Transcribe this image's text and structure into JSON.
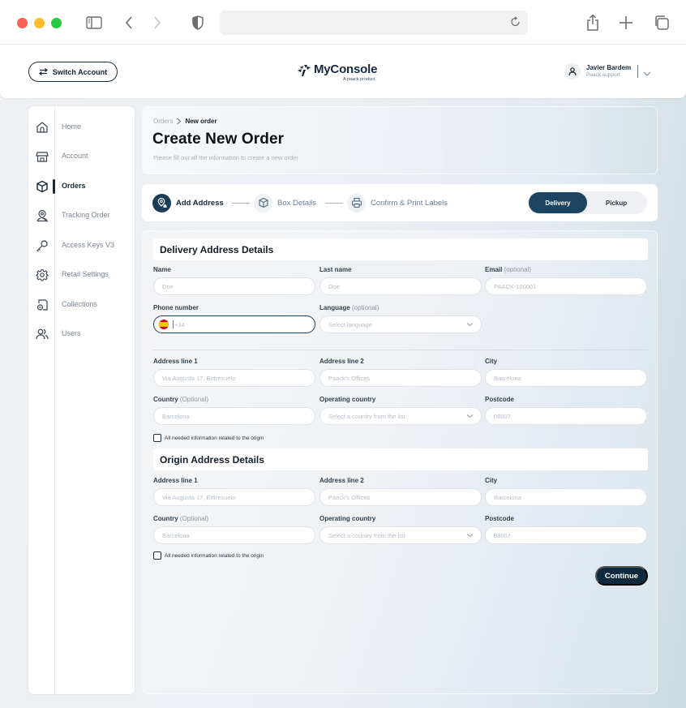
{
  "browser": {
    "icons": [
      "sidebar-toggle-icon",
      "back-icon",
      "forward-icon",
      "privacy-shield-icon",
      "reload-icon",
      "share-icon",
      "new-tab-icon",
      "tabs-overview-icon"
    ],
    "url": ""
  },
  "header": {
    "switch_account_label": "Switch Account",
    "logo_title": "MyConsole",
    "logo_subtitle": "A paack product",
    "user_name": "Javier Bardem",
    "user_role": "Paack support"
  },
  "sidebar": {
    "items": [
      {
        "label": "Home",
        "icon": "home-icon",
        "active": false
      },
      {
        "label": "Account",
        "icon": "store-icon",
        "active": false
      },
      {
        "label": "Orders",
        "icon": "package-icon",
        "active": true
      },
      {
        "label": "Tracking Order",
        "icon": "location-user-icon",
        "active": false
      },
      {
        "label": "Access Keys V3",
        "icon": "key-icon",
        "active": false
      },
      {
        "label": "Retail Settings",
        "icon": "gear-icon",
        "active": false
      },
      {
        "label": "Collections",
        "icon": "collections-icon",
        "active": false
      },
      {
        "label": "Users",
        "icon": "users-icon",
        "active": false
      }
    ]
  },
  "page": {
    "breadcrumb": [
      "Orders",
      "New order"
    ],
    "title": "Create New Order",
    "subtitle": "Please fill out all the information to create a new order"
  },
  "stepper": {
    "steps": [
      {
        "label": "Add Address",
        "active": true
      },
      {
        "label": "Box Details",
        "active": false
      },
      {
        "label": "Confirm & Print Labels",
        "active": false
      }
    ],
    "mode_options": [
      "Delivery",
      "Pickup"
    ],
    "selected_mode": "Delivery"
  },
  "delivery": {
    "title": "Delivery Address Details",
    "name": {
      "label": "Name",
      "placeholder": "Doe"
    },
    "last_name": {
      "label": "Last name",
      "placeholder": "Doe"
    },
    "email": {
      "label": "Email",
      "optional": "(optional)",
      "placeholder": "PAACK-100001"
    },
    "phone": {
      "label": "Phone number",
      "placeholder": "+34",
      "country_flag": "ES"
    },
    "language": {
      "label": "Language",
      "optional": "(optional)",
      "placeholder": "Select language"
    },
    "address1": {
      "label": "Address line 1",
      "placeholder": "Via Augusta 17, Entresuelo"
    },
    "address2": {
      "label": "Address line 2",
      "placeholder": "Paack's Offices"
    },
    "city": {
      "label": "City",
      "placeholder": "Barcelona"
    },
    "country": {
      "label": "Country",
      "optional": "(Optional)",
      "placeholder": "Barcelona"
    },
    "operating_country": {
      "label": "Operating country",
      "placeholder": "Select a country from the list"
    },
    "postcode": {
      "label": "Postcode",
      "placeholder": "08007"
    },
    "checkbox_label": "All needed information related to the origin",
    "checkbox_checked": false
  },
  "origin": {
    "title": "Origin Address Details",
    "address1": {
      "label": "Address line 1",
      "placeholder": "Via Augusta 17, Entresuelo"
    },
    "address2": {
      "label": "Address line 2",
      "placeholder": "Paack's Offices"
    },
    "city": {
      "label": "City",
      "placeholder": "Barcelona"
    },
    "country": {
      "label": "Country",
      "optional": "(Optional)",
      "placeholder": "Barcelona"
    },
    "operating_country": {
      "label": "Operating country",
      "placeholder": "Select a country from the list"
    },
    "postcode": {
      "label": "Postcode",
      "placeholder": "08007"
    },
    "checkbox_label": "All needed information related to the origin",
    "checkbox_checked": false
  },
  "actions": {
    "continue_label": "Continue"
  },
  "colors": {
    "primary": "#1a4460",
    "primary_dark": "#0f2a3d"
  }
}
